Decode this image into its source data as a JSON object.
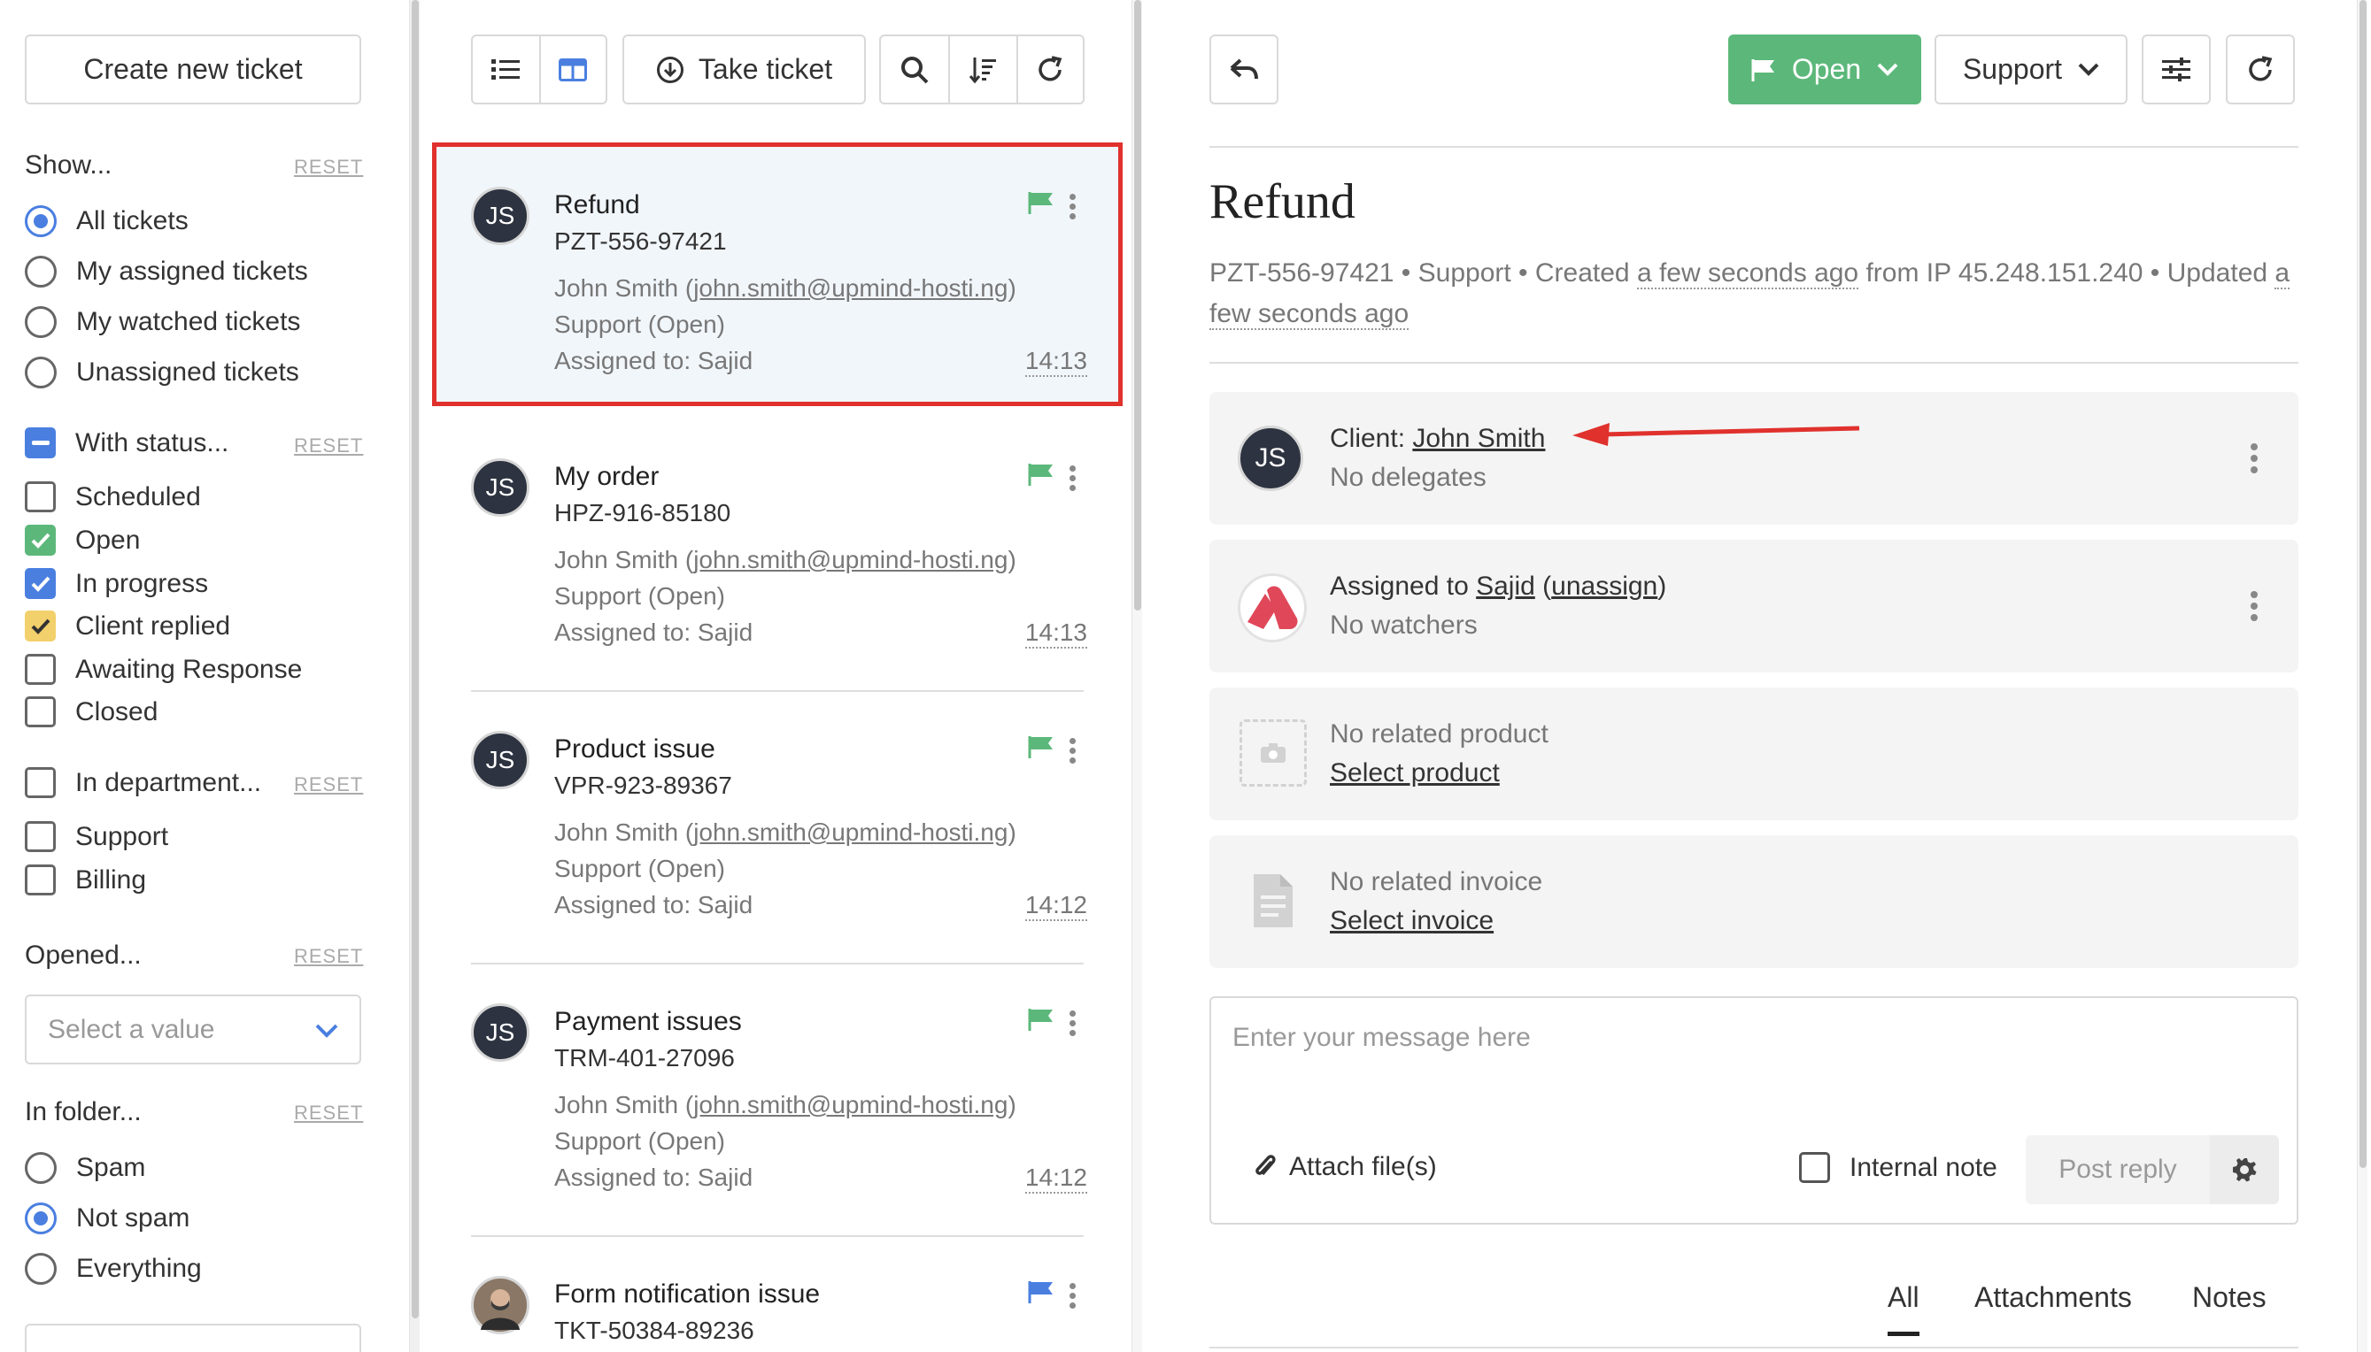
{
  "sidebar": {
    "create_label": "Create new ticket",
    "show": {
      "title": "Show...",
      "reset": "RESET",
      "options": [
        "All tickets",
        "My assigned tickets",
        "My watched tickets",
        "Unassigned tickets"
      ]
    },
    "status": {
      "title": "With status...",
      "reset": "RESET",
      "options": [
        "Scheduled",
        "Open",
        "In progress",
        "Client replied",
        "Awaiting Response",
        "Closed"
      ]
    },
    "department": {
      "title": "In department...",
      "reset": "RESET",
      "options": [
        "Support",
        "Billing"
      ]
    },
    "opened": {
      "title": "Opened...",
      "reset": "RESET",
      "placeholder": "Select a value"
    },
    "folder": {
      "title": "In folder...",
      "reset": "RESET",
      "options": [
        "Spam",
        "Not spam",
        "Everything"
      ]
    }
  },
  "toolbar": {
    "take_label": "Take ticket"
  },
  "tickets": [
    {
      "initials": "JS",
      "title": "Refund",
      "id": "PZT-556-97421",
      "client": "John Smith",
      "email": "john.smith@upmind-hosti.ng",
      "status": "Support (Open)",
      "assigned": "Assigned to: Sajid",
      "time": "14:13",
      "flag_color": "#5cb87a"
    },
    {
      "initials": "JS",
      "title": "My order",
      "id": "HPZ-916-85180",
      "client": "John Smith",
      "email": "john.smith@upmind-hosti.ng",
      "status": "Support (Open)",
      "assigned": "Assigned to: Sajid",
      "time": "14:13",
      "flag_color": "#5cb87a"
    },
    {
      "initials": "JS",
      "title": "Product issue",
      "id": "VPR-923-89367",
      "client": "John Smith",
      "email": "john.smith@upmind-hosti.ng",
      "status": "Support (Open)",
      "assigned": "Assigned to: Sajid",
      "time": "14:12",
      "flag_color": "#5cb87a"
    },
    {
      "initials": "JS",
      "title": "Payment issues",
      "id": "TRM-401-27096",
      "client": "John Smith",
      "email": "john.smith@upmind-hosti.ng",
      "status": "Support (Open)",
      "assigned": "Assigned to: Sajid",
      "time": "14:12",
      "flag_color": "#5cb87a"
    },
    {
      "initials": "",
      "title": "Form notification issue",
      "id": "TKT-50384-89236",
      "flag_color": "#4a7fe0"
    }
  ],
  "detail": {
    "status_label": "Open",
    "department_label": "Support",
    "title": "Refund",
    "meta_pre": "PZT-556-97421 • Support • Created ",
    "meta_created": "a few seconds ago",
    "meta_mid": " from IP 45.248.151.240 • Updated ",
    "meta_updated": "a few seconds ago",
    "client": {
      "initials": "JS",
      "prefix": "Client: ",
      "name": "John Smith",
      "sub": "No delegates"
    },
    "assigned": {
      "prefix": "Assigned to ",
      "name": "Sajid",
      "unassign": "unassign",
      "sub": "No watchers"
    },
    "product": {
      "title": "No related product",
      "link": "Select product"
    },
    "invoice": {
      "title": "No related invoice",
      "link": "Select invoice"
    },
    "composer": {
      "placeholder": "Enter your message here",
      "attach": "Attach file(s)",
      "internal": "Internal note",
      "post": "Post reply"
    },
    "tabs": [
      "All",
      "Attachments",
      "Notes"
    ]
  },
  "colors": {
    "accent": "#4a7fe0",
    "open": "#5cb87a",
    "highlight": "#e0312d"
  }
}
